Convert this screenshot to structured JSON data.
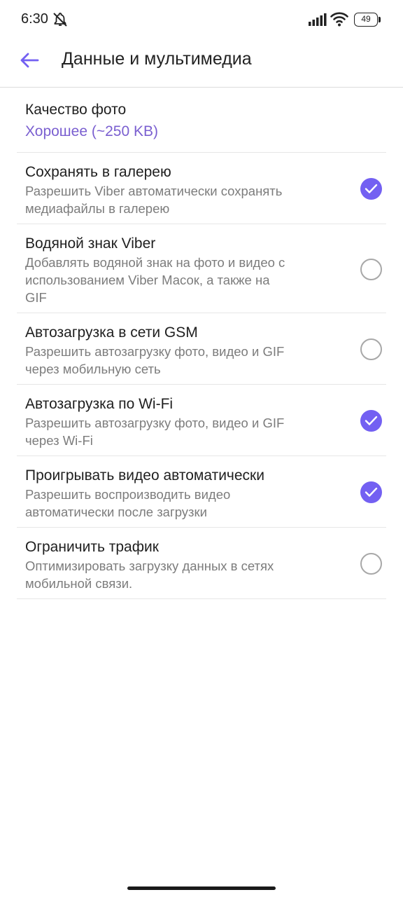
{
  "status": {
    "time": "6:30",
    "battery": "49"
  },
  "header": {
    "title": "Данные и мультимедиа"
  },
  "photo_quality": {
    "title": "Качество фото",
    "value": "Хорошее (~250 KB)"
  },
  "settings": [
    {
      "title": "Сохранять в галерею",
      "subtitle_lines": [
        "Разрешить Viber автоматически сохранять",
        "медиафайлы в галерею"
      ],
      "checked": true
    },
    {
      "title": "Водяной знак Viber",
      "subtitle_lines": [
        "Добавлять водяной знак на фото и видео с",
        "использованием Viber Масок, а также на",
        "GIF"
      ],
      "checked": false
    },
    {
      "title": "Автозагрузка в сети GSM",
      "subtitle_lines": [
        "Разрешить автозагрузку фото, видео и GIF",
        "через мобильную сеть"
      ],
      "checked": false
    },
    {
      "title": "Автозагрузка по Wi-Fi",
      "subtitle_lines": [
        "Разрешить автозагрузку фото, видео и GIF",
        "через Wi-Fi"
      ],
      "checked": true
    },
    {
      "title": "Проигрывать видео автоматически",
      "subtitle_lines": [
        "Разрешить воспроизводить видео",
        "автоматически после загрузки"
      ],
      "checked": true
    },
    {
      "title": "Ограничить трафик",
      "subtitle_lines": [
        "Оптимизировать загрузку данных в сетях",
        "мобильной связи."
      ],
      "checked": false
    }
  ],
  "colors": {
    "accent": "#7360f2",
    "value_text": "#7a5fd0"
  },
  "icons": [
    "mute-icon",
    "signal-icon",
    "wifi-icon",
    "battery-icon",
    "back-arrow-icon",
    "checkmark-icon"
  ]
}
